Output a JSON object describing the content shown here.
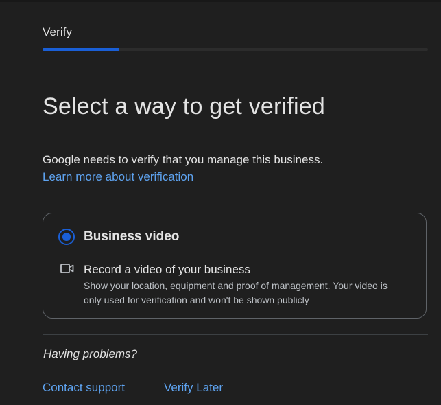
{
  "stepper": {
    "label": "Verify",
    "progress_fraction": 0.2
  },
  "title": "Select a way to get verified",
  "intro": {
    "text": "Google needs to verify that you manage this business.",
    "link": "Learn more about verification"
  },
  "option": {
    "selected": true,
    "title": "Business video",
    "icon": "video-camera-icon",
    "detail_title": "Record a video of your business",
    "detail_description": "Show your location, equipment and proof of management. Your video is only used for verification and won't be shown publicly"
  },
  "footer": {
    "problems": "Having problems?",
    "contact_link": "Contact support",
    "later_link": "Verify Later"
  },
  "colors": {
    "background": "#1f1f1f",
    "accent": "#1a5fd6",
    "link": "#5ea3f0",
    "text": "#e3e3e3",
    "border": "#5f6368"
  }
}
